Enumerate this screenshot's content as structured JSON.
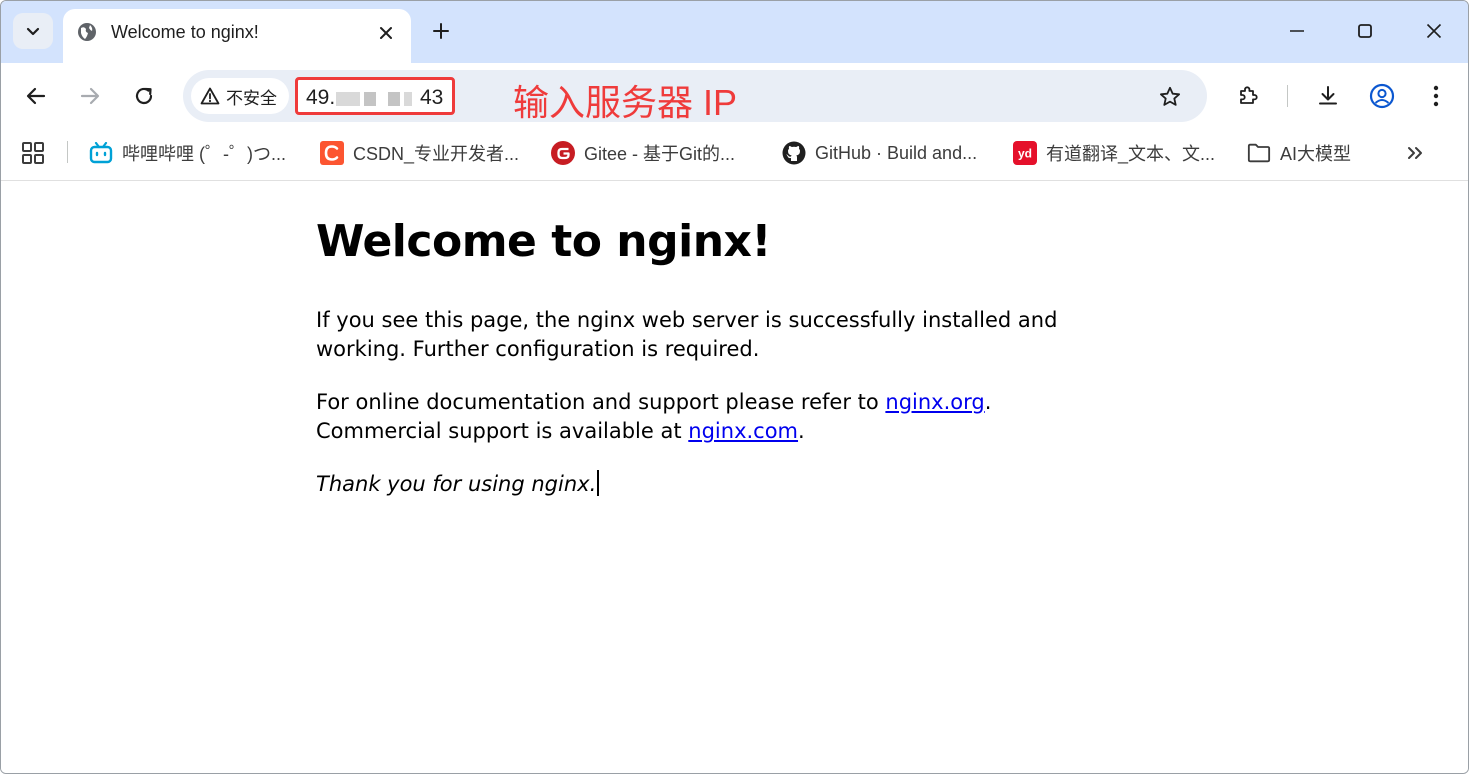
{
  "tab": {
    "title": "Welcome to nginx!"
  },
  "omnibox": {
    "security_label": "不安全",
    "url_prefix": "49.",
    "url_suffix": "43",
    "annotation": "输入服务器 IP"
  },
  "bookmarks": [
    {
      "label": "哔哩哔哩 (゜-゜)つ...",
      "icon": "bilibili-icon"
    },
    {
      "label": "CSDN_专业开发者...",
      "icon": "csdn-icon"
    },
    {
      "label": "Gitee - 基于Git的...",
      "icon": "gitee-icon"
    },
    {
      "label": "GitHub · Build and...",
      "icon": "github-icon"
    },
    {
      "label": "有道翻译_文本、文...",
      "icon": "youdao-icon"
    },
    {
      "label": "AI大模型",
      "icon": "folder-icon"
    }
  ],
  "page": {
    "heading": "Welcome to nginx!",
    "para1": "If you see this page, the nginx web server is successfully installed and working. Further configuration is required.",
    "para2_before": "For online documentation and support please refer to ",
    "para2_link": "nginx.org",
    "para2_after": ".",
    "para3_before": "Commercial support is available at ",
    "para3_link": "nginx.com",
    "para3_after": ".",
    "thanks": "Thank you for using nginx."
  },
  "colors": {
    "accent_blue": "#0b57d0",
    "annotation_red": "#ef3b3b",
    "link": "#0000ee",
    "tabstrip": "#d3e3fd"
  }
}
